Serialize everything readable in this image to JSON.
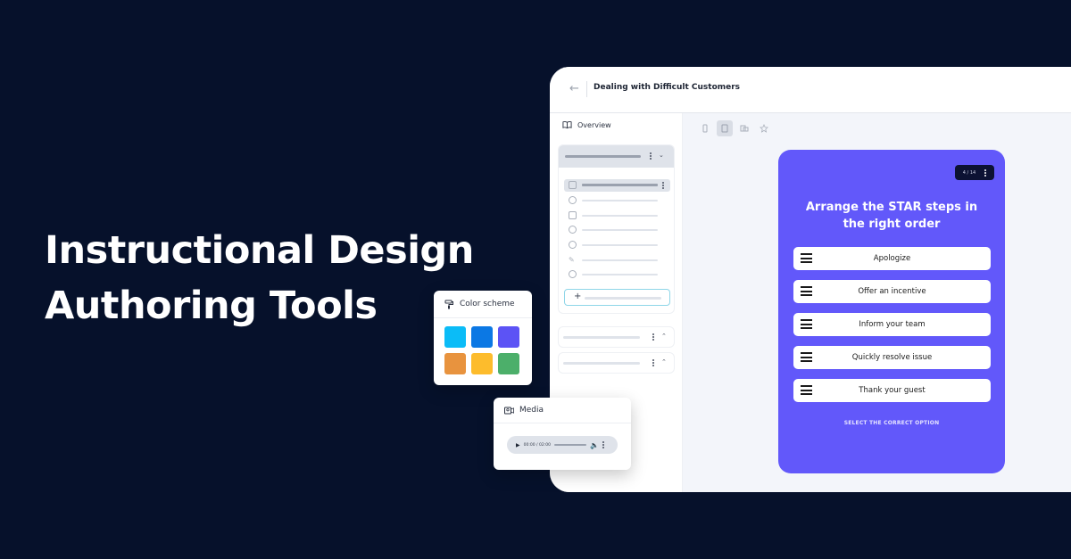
{
  "hero": {
    "line1": "Instructional Design",
    "line2": "Authoring Tools"
  },
  "app": {
    "title": "Dealing with Difficult Customers",
    "back_icon": "arrow-left-icon",
    "sidebar": {
      "overview_label": "Overview",
      "overview_icon": "book-open-icon"
    },
    "toolbar": {
      "tools": [
        "mobile-view",
        "tablet-view",
        "desktop-view",
        "favorite"
      ],
      "active": "tablet-view"
    },
    "card": {
      "counter": "4 / 14",
      "question": "Arrange the STAR steps in the right order",
      "options": [
        "Apologize",
        "Offer an incentive",
        "Inform your team",
        "Quickly resolve issue",
        "Thank your guest"
      ],
      "hint": "SELECT THE CORRECT OPTION",
      "background": "#6258fa"
    }
  },
  "color_scheme": {
    "title": "Color scheme",
    "icon": "paint-roller-icon",
    "swatches": [
      "#0bbcf7",
      "#0b78e4",
      "#5c53f5",
      "#e8933e",
      "#fdbc2c",
      "#4caf6a"
    ]
  },
  "media": {
    "title": "Media",
    "icon": "video-icon",
    "player_time": "00:00 / 02:00"
  }
}
